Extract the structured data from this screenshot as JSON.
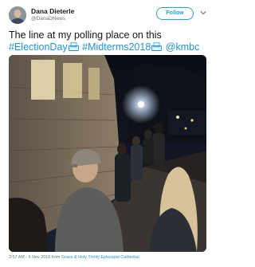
{
  "author": {
    "name": "Dana Dieterle",
    "handle": "@DanaDNews"
  },
  "follow_label": "Follow",
  "icons": {
    "avatar": "avatar-photo",
    "menu": "chevron-down-icon",
    "hashtag_emoji": "ballot-box-icon"
  },
  "tweet": {
    "text_line1": "The line at my polling place on this",
    "hashtag_election": "#ElectionDay",
    "hashtag_midterms": "#Midterms2018",
    "mention": "@kmbc"
  },
  "meta": {
    "timestamp": "3:57 AM - 6 Nov 2018 from",
    "place": "Grace & Holy Trinity Episcopal Cathedral"
  },
  "colors": {
    "link": "#1b95e0",
    "follow_border": "#1da1f2",
    "text": "#14171a",
    "secondary": "#657786"
  }
}
